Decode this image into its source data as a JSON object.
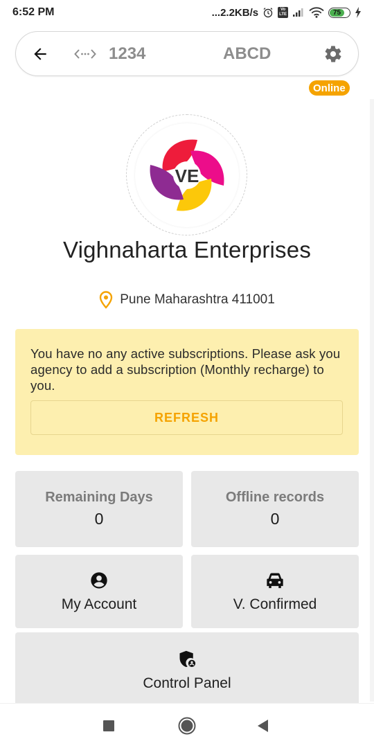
{
  "status_bar": {
    "time": "6:52 PM",
    "network_speed": "...2.2KB/s",
    "volte_label": "Vo LTE",
    "battery_level": "75",
    "icons": [
      "alarm-icon",
      "volte-icon",
      "signal-icon",
      "wifi-icon",
      "battery-icon",
      "charging-icon"
    ]
  },
  "top_bar": {
    "back_icon": "arrow-left-icon",
    "code_icon": "code-brackets-icon",
    "code_value": "1234",
    "name_value": "ABCD",
    "settings_icon": "gear-icon"
  },
  "status_badge": "Online",
  "profile": {
    "logo_text": "VE",
    "company_name": "Vighnaharta Enterprises",
    "location_icon": "location-pin-icon",
    "location": "Pune Maharashtra 411001"
  },
  "alert": {
    "message": "You have no any active subscriptions. Please ask you agency to add a subscription (Monthly recharge) to you.",
    "refresh_label": "REFRESH"
  },
  "stats": [
    {
      "label": "Remaining Days",
      "value": "0"
    },
    {
      "label": "Offline records",
      "value": "0"
    }
  ],
  "actions": [
    {
      "label": "My Account",
      "icon": "account-circle-icon"
    },
    {
      "label": "V. Confirmed",
      "icon": "car-icon"
    },
    {
      "label": "Control Panel",
      "icon": "admin-shield-icon"
    }
  ],
  "nav_bar": {
    "recents_icon": "square-icon",
    "home_icon": "circle-icon",
    "back_icon": "triangle-back-icon"
  },
  "colors": {
    "accent": "#f5a300",
    "alert_bg": "#fdefaf",
    "card_bg": "#e8e8e8",
    "battery_green": "#4caf50"
  }
}
